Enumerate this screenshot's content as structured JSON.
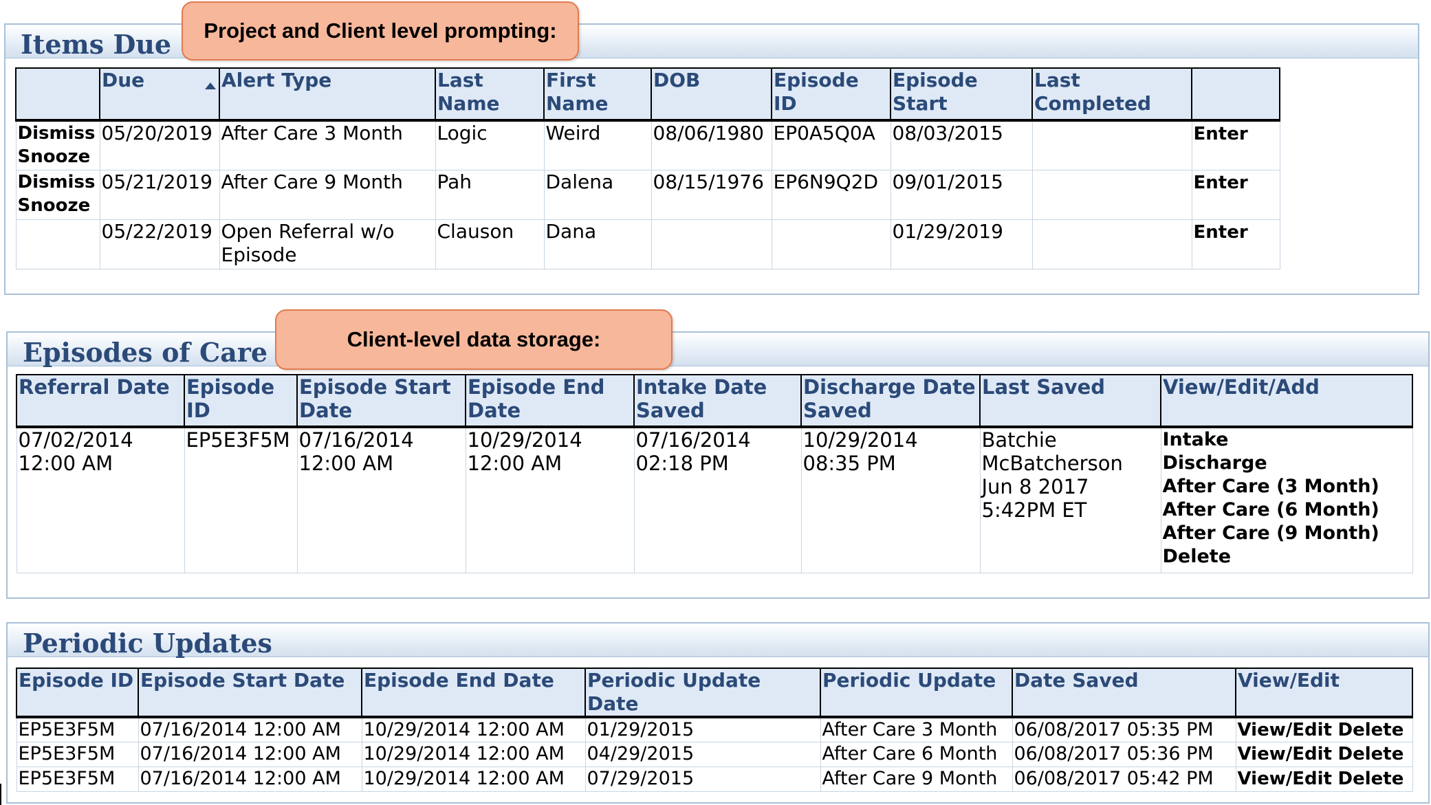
{
  "items_due": {
    "title": "Items Due",
    "callout": "Project and Client level prompting:",
    "columns": [
      "",
      "Due",
      "Alert Type",
      "Last Name",
      "First Name",
      "DOB",
      "Episode ID",
      "Episode Start",
      "Last Completed",
      ""
    ],
    "rows": [
      {
        "dismiss": "Dismiss",
        "snooze": "Snooze",
        "due": "05/20/2019",
        "alert_type": "After Care 3 Month",
        "last_name": "Logic",
        "first_name": "Weird",
        "dob": "08/06/1980",
        "episode_id": "EP0A5Q0A",
        "episode_start": "08/03/2015",
        "last_completed": "",
        "action": "Enter"
      },
      {
        "dismiss": "Dismiss",
        "snooze": "Snooze",
        "due": "05/21/2019",
        "alert_type": "After Care 9 Month",
        "last_name": "Pah",
        "first_name": "Dalena",
        "dob": "08/15/1976",
        "episode_id": "EP6N9Q2D",
        "episode_start": "09/01/2015",
        "last_completed": "",
        "action": "Enter"
      },
      {
        "dismiss": "",
        "snooze": "",
        "due": "05/22/2019",
        "alert_type": "Open Referral w/o Episode",
        "last_name": "Clauson",
        "first_name": "Dana",
        "dob": "",
        "episode_id": "",
        "episode_start": "01/29/2019",
        "last_completed": "",
        "action": "Enter"
      }
    ]
  },
  "episodes": {
    "title": "Episodes of Care",
    "callout": "Client-level data storage:",
    "columns": [
      "Referral Date",
      "Episode ID",
      "Episode Start Date",
      "Episode End Date",
      "Intake Date Saved",
      "Discharge Date Saved",
      "Last Saved",
      "View/Edit/Add"
    ],
    "rows": [
      {
        "referral_date": "07/02/2014",
        "referral_time": "12:00 AM",
        "episode_id": "EP5E3F5M",
        "start_date": "07/16/2014",
        "start_time": "12:00 AM",
        "end_date": "10/29/2014",
        "end_time": "12:00 AM",
        "intake_date": "07/16/2014",
        "intake_time": "02:18 PM",
        "discharge_date": "10/29/2014",
        "discharge_time": "08:35 PM",
        "last_saved": [
          "Batchie",
          "McBatcherson",
          "Jun 8 2017",
          "5:42PM ET"
        ],
        "actions": [
          "Intake",
          "Discharge",
          "After Care (3 Month)",
          "After Care (6 Month)",
          "After Care (9 Month)",
          "Delete"
        ]
      }
    ]
  },
  "periodic": {
    "title": "Periodic Updates",
    "columns": [
      "Episode ID",
      "Episode Start Date",
      "Episode End Date",
      "Periodic Update Date",
      "Periodic Update",
      "Date Saved",
      "View/Edit"
    ],
    "rows": [
      {
        "episode_id": "EP5E3F5M",
        "start": "07/16/2014 12:00 AM",
        "end": "10/29/2014 12:00 AM",
        "update_date": "01/29/2015",
        "update": "After Care 3 Month",
        "saved": "06/08/2017 05:35 PM",
        "view_edit": "View/Edit",
        "delete": "Delete"
      },
      {
        "episode_id": "EP5E3F5M",
        "start": "07/16/2014 12:00 AM",
        "end": "10/29/2014 12:00 AM",
        "update_date": "04/29/2015",
        "update": "After Care 6 Month",
        "saved": "06/08/2017 05:36 PM",
        "view_edit": "View/Edit",
        "delete": "Delete"
      },
      {
        "episode_id": "EP5E3F5M",
        "start": "07/16/2014 12:00 AM",
        "end": "10/29/2014 12:00 AM",
        "update_date": "07/29/2015",
        "update": "After Care 9 Month",
        "saved": "06/08/2017 05:42 PM",
        "view_edit": "View/Edit",
        "delete": "Delete"
      }
    ]
  }
}
